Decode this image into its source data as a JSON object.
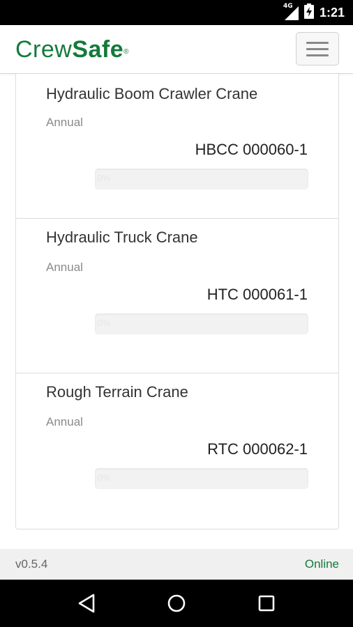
{
  "status_bar": {
    "network": "4G",
    "time": "1:21"
  },
  "header": {
    "logo_part1": "Crew",
    "logo_part2": "Safe",
    "logo_mark": "®",
    "menu_icon": "hamburger-icon"
  },
  "items": [
    {
      "title": "Hydraulic Boom Crawler Crane",
      "frequency": "Annual",
      "code": "HBCC 000060-1",
      "progress_label": "0%",
      "progress_fraction": 0
    },
    {
      "title": "Hydraulic Truck Crane",
      "frequency": "Annual",
      "code": "HTC 000061-1",
      "progress_label": "0%",
      "progress_fraction": 0
    },
    {
      "title": "Rough Terrain Crane",
      "frequency": "Annual",
      "code": "RTC 000062-1",
      "progress_label": "0%",
      "progress_fraction": 0
    }
  ],
  "footer": {
    "version": "v0.5.4",
    "status": "Online"
  },
  "nav_bar": {
    "back_icon": "back-triangle-icon",
    "home_icon": "home-circle-icon",
    "recents_icon": "recents-square-icon"
  },
  "colors": {
    "brand_green": "#137a3b"
  }
}
